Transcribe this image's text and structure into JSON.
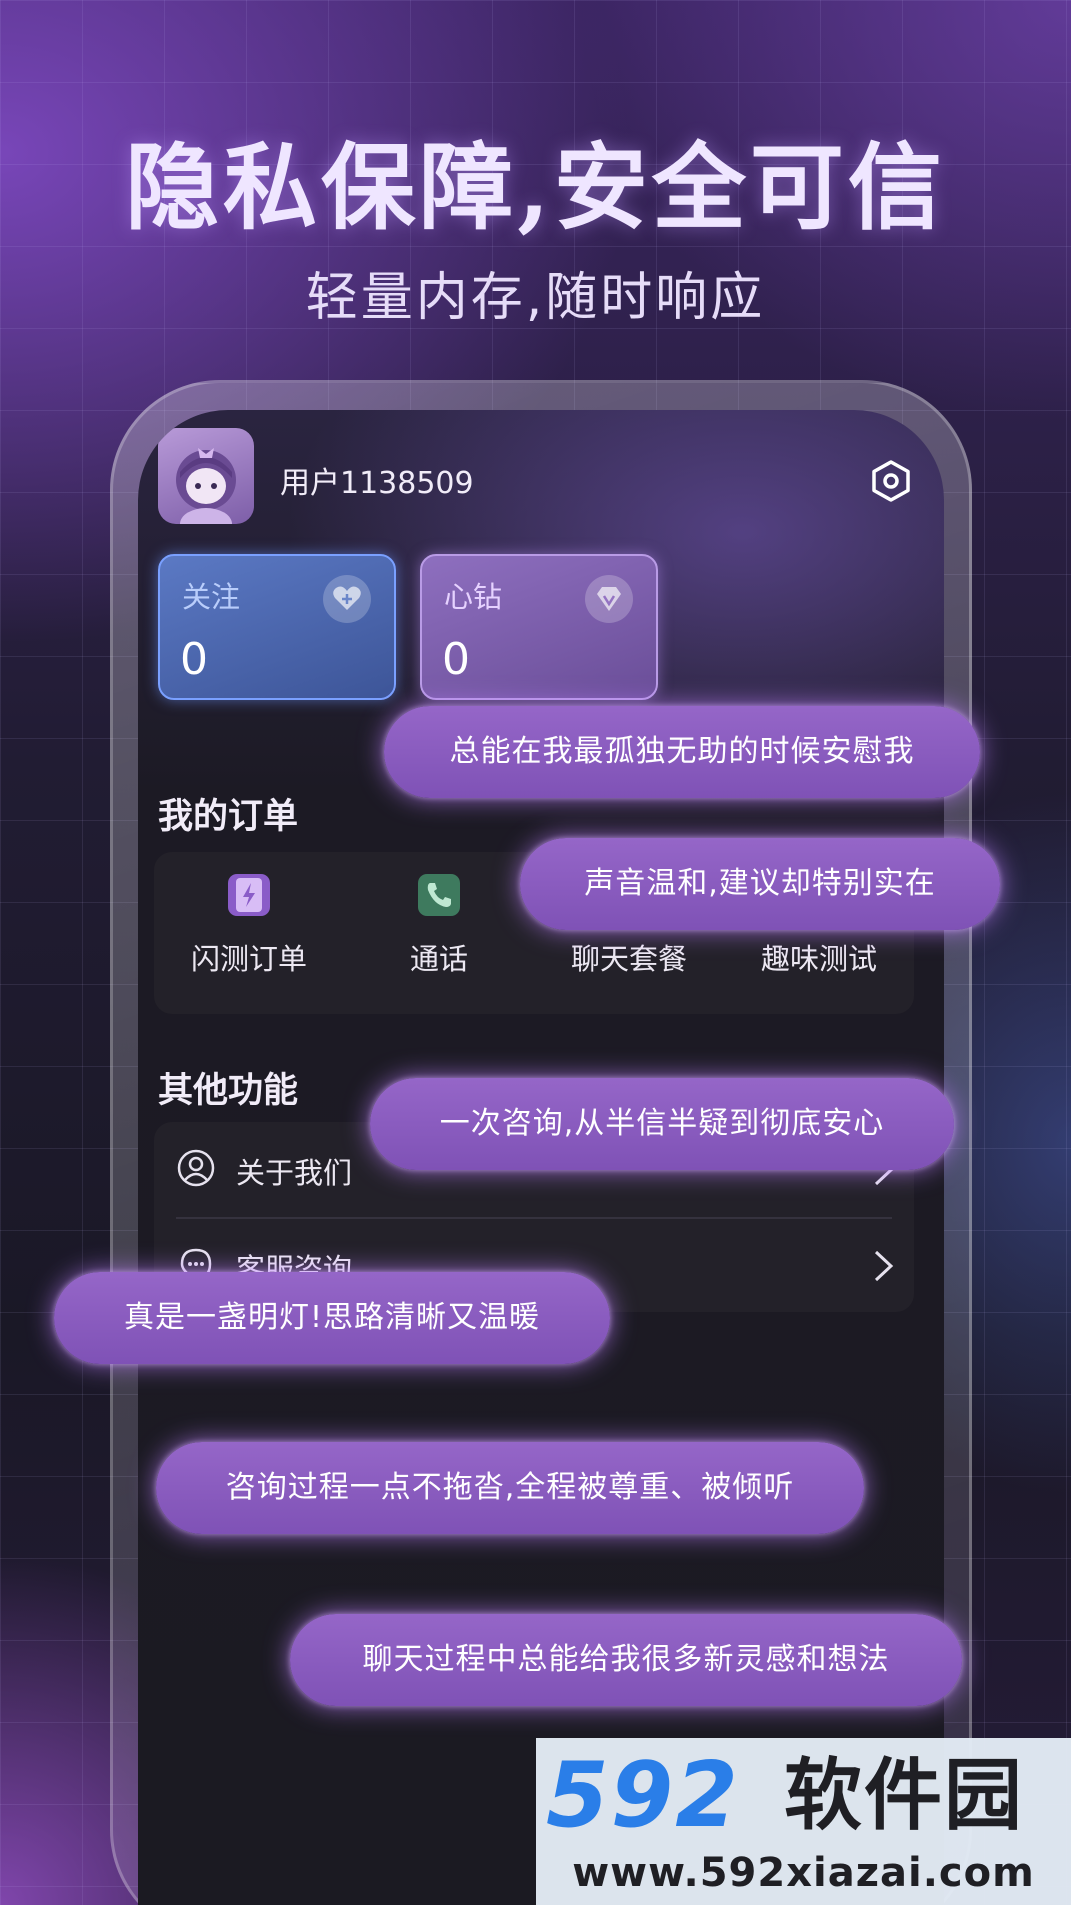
{
  "headline": "隐私保障,安全可信",
  "subheadline": "轻量内存,随时响应",
  "profile": {
    "username": "用户1138509",
    "avatar_icon": "avatar-icon",
    "settings_icon": "gear-icon"
  },
  "stats": [
    {
      "label": "关注",
      "value": "0",
      "icon": "heart-icon",
      "color": "#5b79c4"
    },
    {
      "label": "心钻",
      "value": "0",
      "icon": "diamond-icon",
      "color": "#8e6fbf"
    }
  ],
  "orders": {
    "title": "我的订单",
    "items": [
      {
        "label": "闪测订单",
        "icon": "flash-icon"
      },
      {
        "label": "通话",
        "icon": "phone-icon"
      },
      {
        "label": "聊天套餐",
        "icon": "chat-icon"
      },
      {
        "label": "趣味测试",
        "icon": "quiz-icon"
      }
    ]
  },
  "functions": {
    "title": "其他功能",
    "items": [
      {
        "label": "关于我们",
        "icon": "user-circle-icon"
      },
      {
        "label": "客服咨询",
        "icon": "service-icon"
      }
    ]
  },
  "reviews": [
    "总能在我最孤独无助的时候安慰我",
    "声音温和,建议却特别实在",
    "一次咨询,从半信半疑到彻底安心",
    "真是一盏明灯!思路清晰又温暖",
    "咨询过程一点不拖沓,全程被尊重、被倾听",
    "聊天过程中总能给我很多新灵感和想法"
  ],
  "watermark": {
    "logo": "592",
    "name": "软件园",
    "url": "www.592xiazai.com"
  },
  "colors": {
    "accent_purple": "#8e5fc6",
    "follow_blue": "#5b79c4",
    "background": "#1b1a22"
  }
}
